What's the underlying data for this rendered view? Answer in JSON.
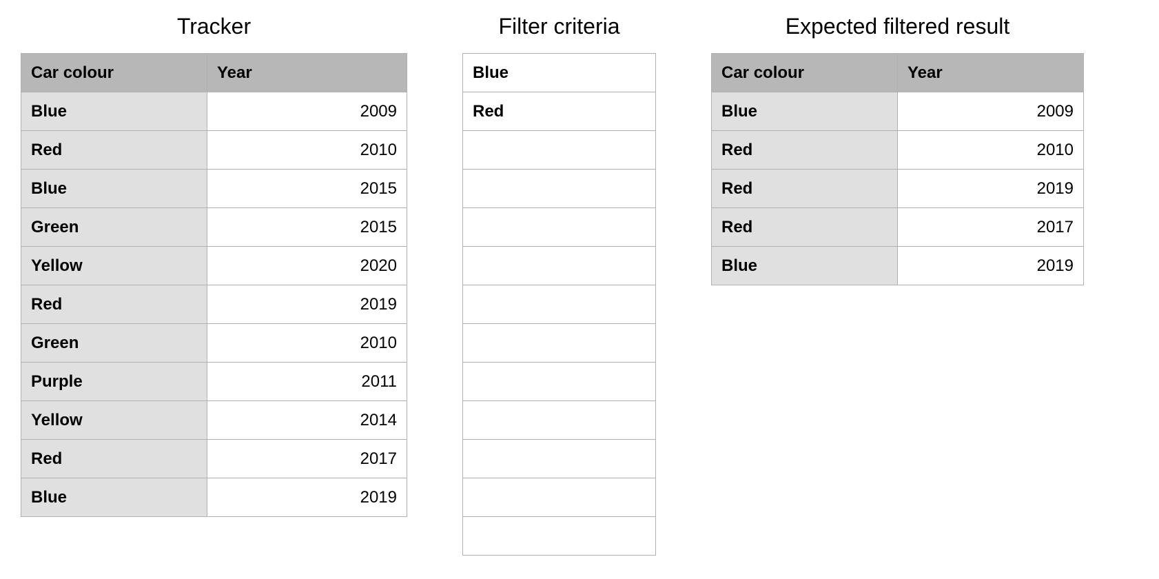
{
  "sections": {
    "tracker": {
      "title": "Tracker",
      "headers": [
        "Car colour",
        "Year"
      ],
      "rows": [
        {
          "colour": "Blue",
          "year": "2009"
        },
        {
          "colour": "Red",
          "year": "2010"
        },
        {
          "colour": "Blue",
          "year": "2015"
        },
        {
          "colour": "Green",
          "year": "2015"
        },
        {
          "colour": "Yellow",
          "year": "2020"
        },
        {
          "colour": "Red",
          "year": "2019"
        },
        {
          "colour": "Green",
          "year": "2010"
        },
        {
          "colour": "Purple",
          "year": "2011"
        },
        {
          "colour": "Yellow",
          "year": "2014"
        },
        {
          "colour": "Red",
          "year": "2017"
        },
        {
          "colour": "Blue",
          "year": "2019"
        }
      ]
    },
    "criteria": {
      "title": "Filter criteria",
      "rows": [
        "Blue",
        "Red",
        "",
        "",
        "",
        "",
        "",
        "",
        "",
        "",
        "",
        "",
        ""
      ]
    },
    "result": {
      "title": "Expected filtered result",
      "headers": [
        "Car colour",
        "Year"
      ],
      "rows": [
        {
          "colour": "Blue",
          "year": "2009"
        },
        {
          "colour": "Red",
          "year": "2010"
        },
        {
          "colour": "Red",
          "year": "2019"
        },
        {
          "colour": "Red",
          "year": "2017"
        },
        {
          "colour": "Blue",
          "year": "2019"
        }
      ]
    }
  }
}
